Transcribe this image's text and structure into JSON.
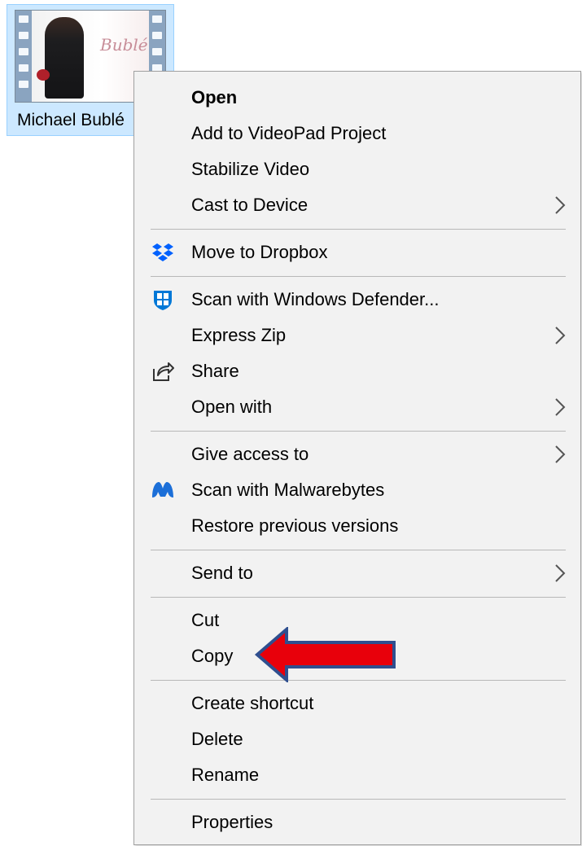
{
  "file": {
    "name": "Michael Bublé",
    "thumbnail_logo": "Bublé",
    "icon": "video-file-thumbnail"
  },
  "menu": {
    "items": [
      {
        "label": "Open",
        "bold": true
      },
      {
        "label": "Add to VideoPad Project"
      },
      {
        "label": "Stabilize Video"
      },
      {
        "label": "Cast to Device",
        "submenu": true
      },
      {
        "label": "Move to Dropbox",
        "icon": "dropbox-icon"
      },
      {
        "label": "Scan with Windows Defender...",
        "icon": "windows-defender-icon"
      },
      {
        "label": "Express Zip",
        "submenu": true
      },
      {
        "label": "Share",
        "icon": "share-icon"
      },
      {
        "label": "Open with",
        "submenu": true
      },
      {
        "label": "Give access to",
        "submenu": true
      },
      {
        "label": "Scan with Malwarebytes",
        "icon": "malwarebytes-icon"
      },
      {
        "label": "Restore previous versions"
      },
      {
        "label": "Send to",
        "submenu": true
      },
      {
        "label": "Cut"
      },
      {
        "label": "Copy"
      },
      {
        "label": "Create shortcut"
      },
      {
        "label": "Delete"
      },
      {
        "label": "Rename"
      },
      {
        "label": "Properties"
      }
    ]
  },
  "colors": {
    "menu_background": "#f2f2f2",
    "selection_background": "#cce8ff",
    "arrow_fill": "#e8000b",
    "arrow_stroke": "#2f4f8f",
    "dropbox_blue": "#0061fe",
    "defender_blue": "#0078d7",
    "malwarebytes_blue": "#1c6fd8"
  },
  "annotation": {
    "type": "arrow",
    "points_to": "Copy"
  }
}
